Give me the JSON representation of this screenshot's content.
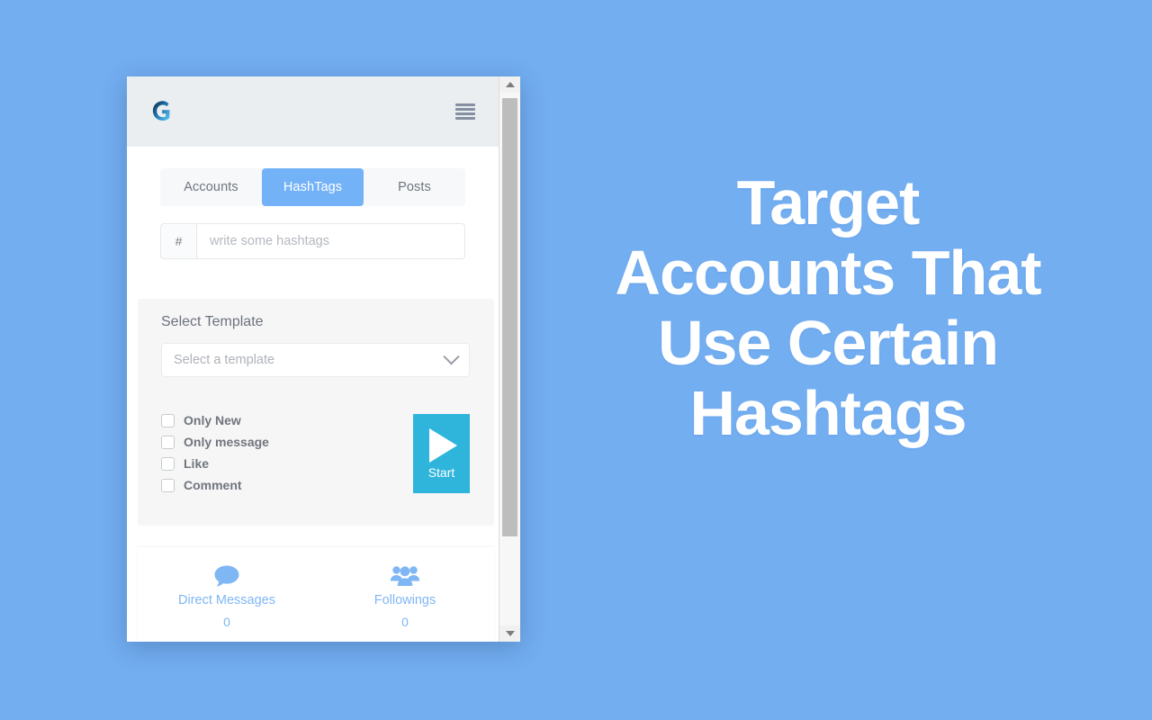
{
  "background_color": "#73AEF1",
  "app": {
    "header": {
      "logo_icon": "g-logo-icon",
      "menu_icon": "hamburger-menu-icon"
    },
    "tabs": [
      {
        "label": "Accounts",
        "active": false
      },
      {
        "label": "HashTags",
        "active": true
      },
      {
        "label": "Posts",
        "active": false
      }
    ],
    "hashtag_field": {
      "prefix": "#",
      "value": "",
      "placeholder": "write some hashtags"
    },
    "template": {
      "section_label": "Select Template",
      "select_value": "Select a template",
      "chevron_icon": "chevron-down-icon"
    },
    "options": [
      {
        "label": "Only New",
        "checked": false
      },
      {
        "label": "Only message",
        "checked": false
      },
      {
        "label": "Like",
        "checked": false
      },
      {
        "label": "Comment",
        "checked": false
      }
    ],
    "start_button": {
      "label": "Start",
      "icon": "play-icon",
      "color": "#2FB5DC"
    },
    "stats": [
      {
        "title": "Direct Messages",
        "value": "0",
        "icon": "speech-bubble-icon"
      },
      {
        "title": "Followings",
        "value": "0",
        "icon": "users-group-icon"
      }
    ],
    "scrollbar": {
      "up_icon": "scroll-up-arrow-icon",
      "down_icon": "scroll-down-arrow-icon"
    },
    "colors": {
      "accent_blue": "#74B2F8",
      "header_bg": "#EAEEF1",
      "card_bg": "#F6F6F7",
      "stat_text": "#7FB6F4"
    }
  },
  "headline": {
    "lines": [
      "Target",
      "Accounts That",
      "Use Certain",
      "Hashtags"
    ]
  }
}
